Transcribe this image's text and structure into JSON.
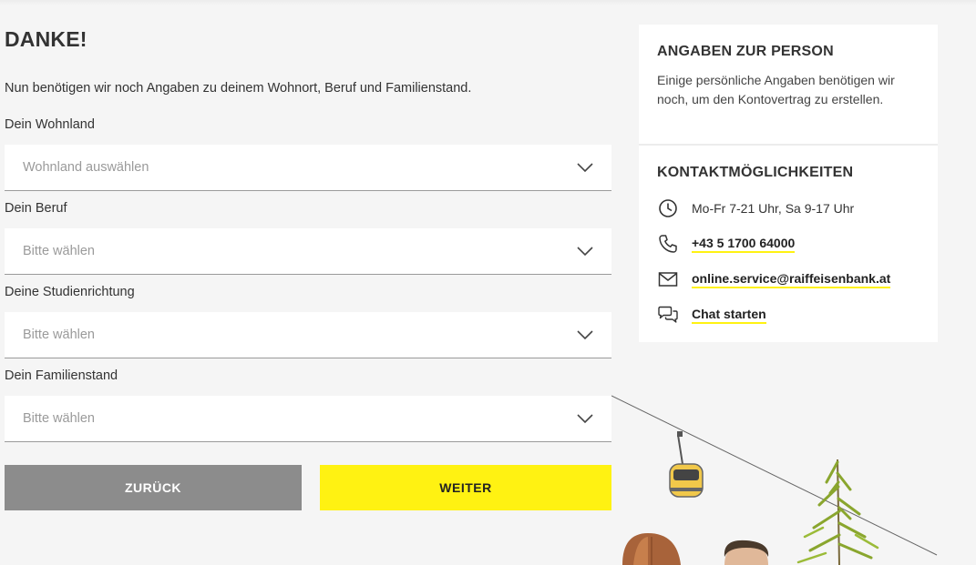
{
  "form": {
    "title": "DANKE!",
    "intro": "Nun benötigen wir noch Angaben zu deinem Wohnort, Beruf und Familienstand.",
    "fields": [
      {
        "label": "Dein Wohnland",
        "placeholder": "Wohnland auswählen"
      },
      {
        "label": "Dein Beruf",
        "placeholder": "Bitte wählen"
      },
      {
        "label": "Deine Studienrichtung",
        "placeholder": "Bitte wählen"
      },
      {
        "label": "Dein Familienstand",
        "placeholder": "Bitte wählen"
      }
    ],
    "back_label": "ZURÜCK",
    "next_label": "WEITER"
  },
  "sidebar": {
    "person": {
      "heading": "ANGABEN ZUR PERSON",
      "text": "Einige persönliche Angaben benötigen wir noch, um den Kontovertrag zu erstellen."
    },
    "contact": {
      "heading": "KONTAKTMÖGLICHKEITEN",
      "hours": "Mo-Fr 7-21 Uhr, Sa 9-17 Uhr",
      "phone": "+43 5 1700 64000",
      "email": "online.service@raiffeisenbank.at",
      "chat": "Chat starten"
    }
  },
  "colors": {
    "accent": "#fff212",
    "back_button": "#8c8c8c",
    "background": "#f5f5f5"
  },
  "icons": [
    "clock-icon",
    "phone-icon",
    "mail-icon",
    "chat-icon",
    "chevron-down-icon"
  ]
}
